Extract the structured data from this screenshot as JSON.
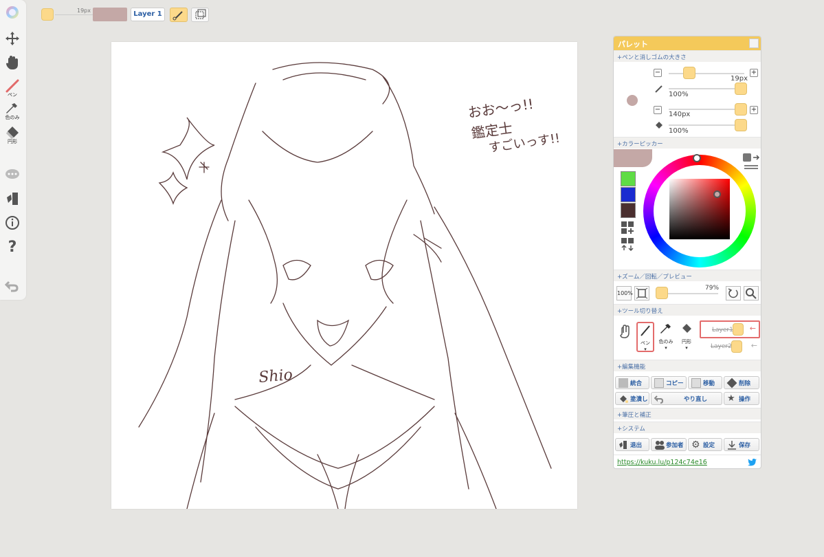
{
  "toolbar_left": {
    "pen_label": "ペン",
    "eyedropper_label": "色のみ",
    "shape_label": "円形"
  },
  "topbar": {
    "size_label": "19px",
    "layer_button": "Layer 1"
  },
  "palette": {
    "title": "パレット",
    "sec_size": "+ペンと消しゴムの大きさ",
    "pen_size": "19px",
    "pen_opacity": "100%",
    "eraser_size": "140px",
    "eraser_opacity": "100%",
    "sec_picker": "+カラーピッカー",
    "sec_zoom": "+ズーム／回転／プレビュー",
    "zoom_reset": "100%",
    "zoom_value": "79%",
    "sec_tools": "+ツール切り替え",
    "tool_pen": "ペン",
    "tool_dropper": "色のみ",
    "tool_shape": "円形",
    "layer1": "Layer1",
    "layer2": "Layer2",
    "sec_edit": "+編集機能",
    "edit_buttons": [
      "統合",
      "コピー",
      "移動",
      "削除",
      "塗潰し",
      "やり直し",
      "操作"
    ],
    "sec_pressure": "+筆圧と補正",
    "sec_system": "+システム",
    "system_buttons": [
      "退出",
      "参加者",
      "設定",
      "保存"
    ],
    "link": "https://kuku.lu/p124c74e16"
  },
  "canvas": {
    "handwriting_1": "おお〜っ!!",
    "handwriting_2": "鑑定士",
    "handwriting_3": "すごいっす!!",
    "signature": "Shio"
  },
  "colors": {
    "current_color": "#c4a8a6",
    "swatch_green": "#5fdc45",
    "swatch_blue": "#1a2bd0",
    "swatch_brown": "#4a2f2f",
    "accent": "#f4c95a"
  }
}
